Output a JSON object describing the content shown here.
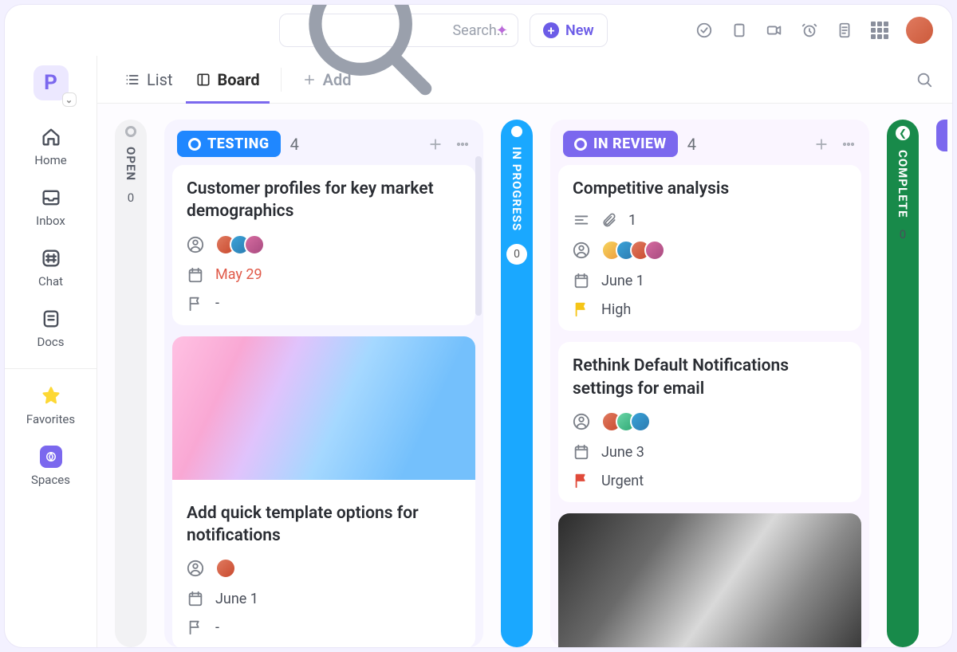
{
  "search": {
    "placeholder": "Search..."
  },
  "newButton": "New",
  "workspaceInitial": "P",
  "nav": {
    "home": "Home",
    "inbox": "Inbox",
    "chat": "Chat",
    "docs": "Docs",
    "favorites": "Favorites",
    "spaces": "Spaces"
  },
  "tabs": {
    "list": "List",
    "board": "Board",
    "add": "Add"
  },
  "columns": {
    "open": {
      "label": "OPEN",
      "count": "0"
    },
    "testing": {
      "label": "TESTING",
      "count": "4"
    },
    "inProgress": {
      "label": "IN PROGRESS",
      "count": "0"
    },
    "inReview": {
      "label": "IN REVIEW",
      "count": "4"
    },
    "complete": {
      "label": "COMPLETE",
      "count": "0"
    }
  },
  "cards": {
    "testing": [
      {
        "title": "Customer profiles for key market demographics",
        "date": "May 29",
        "dateDanger": true,
        "priority": "-",
        "assignees": 3
      },
      {
        "title": "Add quick template options for notifications",
        "date": "June 1",
        "dateDanger": false,
        "priority": "-",
        "assignees": 1,
        "cover": "color"
      }
    ],
    "inReview": [
      {
        "title": "Competitive analysis",
        "attachments": "1",
        "date": "June 1",
        "priority": "High",
        "priorityColor": "y",
        "assignees": 4
      },
      {
        "title": "Rethink Default Notifications settings for email",
        "date": "June 3",
        "priority": "Urgent",
        "priorityColor": "r",
        "assignees": 3
      },
      {
        "cover": "bw"
      }
    ]
  }
}
